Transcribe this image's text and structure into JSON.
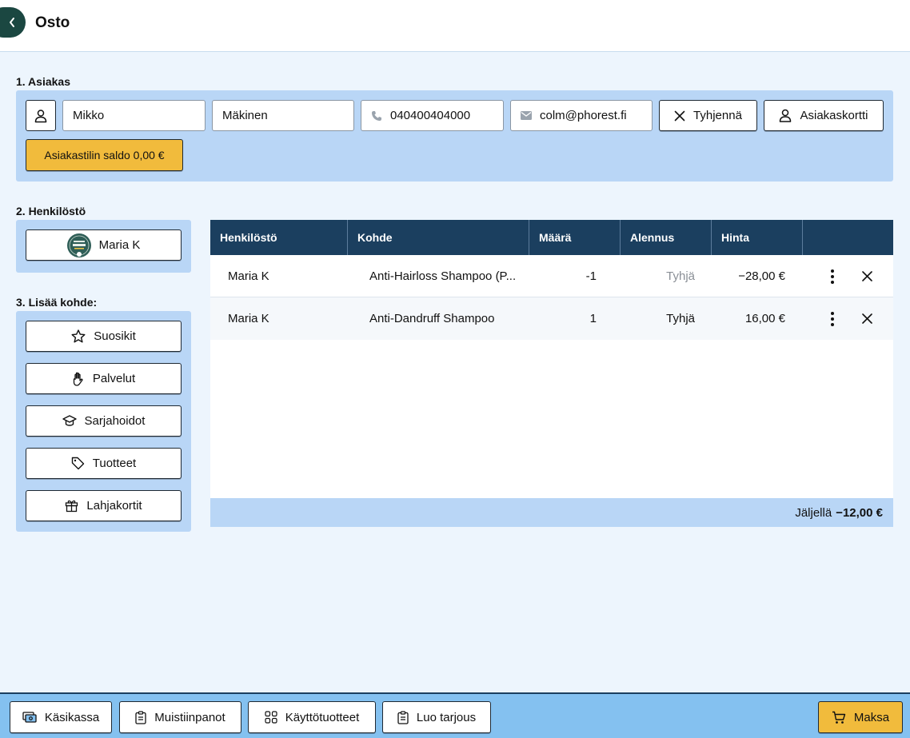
{
  "header": {
    "title": "Osto",
    "back_icon": "chevron-left-icon"
  },
  "customer": {
    "section_label": "1. Asiakas",
    "first_name": "Mikko",
    "last_name": "Mäkinen",
    "phone": "040400404000",
    "email": "colm@phorest.fi",
    "clear_label": "Tyhjennä",
    "card_label": "Asiakaskortti",
    "balance_label": "Asiakastilin saldo 0,00 €"
  },
  "staff": {
    "section_label": "2. Henkilöstö",
    "selected": "Maria K"
  },
  "add_item": {
    "section_label": "3. Lisää kohde:",
    "buttons": [
      "Suosikit",
      "Palvelut",
      "Sarjahoidot",
      "Tuotteet",
      "Lahjakortit"
    ]
  },
  "table": {
    "headers": [
      "Henkilöstö",
      "Kohde",
      "Määrä",
      "Alennus",
      "Hinta"
    ],
    "rows": [
      {
        "staff": "Maria K",
        "item": "Anti-Hairloss Shampoo (P...",
        "qty": "-1",
        "discount": "Tyhjä",
        "price": "−28,00 €"
      },
      {
        "staff": "Maria K",
        "item": "Anti-Dandruff Shampoo",
        "qty": "1",
        "discount": "Tyhjä",
        "price": "16,00 €"
      }
    ],
    "remaining_label": "Jäljellä",
    "remaining_value": "−12,00 €"
  },
  "footer": {
    "buttons": [
      "Käsikassa",
      "Muistiinpanot",
      "Käyttötuotteet",
      "Luo tarjous"
    ],
    "pay_label": "Maksa"
  },
  "colors": {
    "accent_yellow": "#f1bb3c",
    "header_dark": "#1b3f5f",
    "panel_blue": "#b9d6f6",
    "back_green": "#1b4741"
  }
}
